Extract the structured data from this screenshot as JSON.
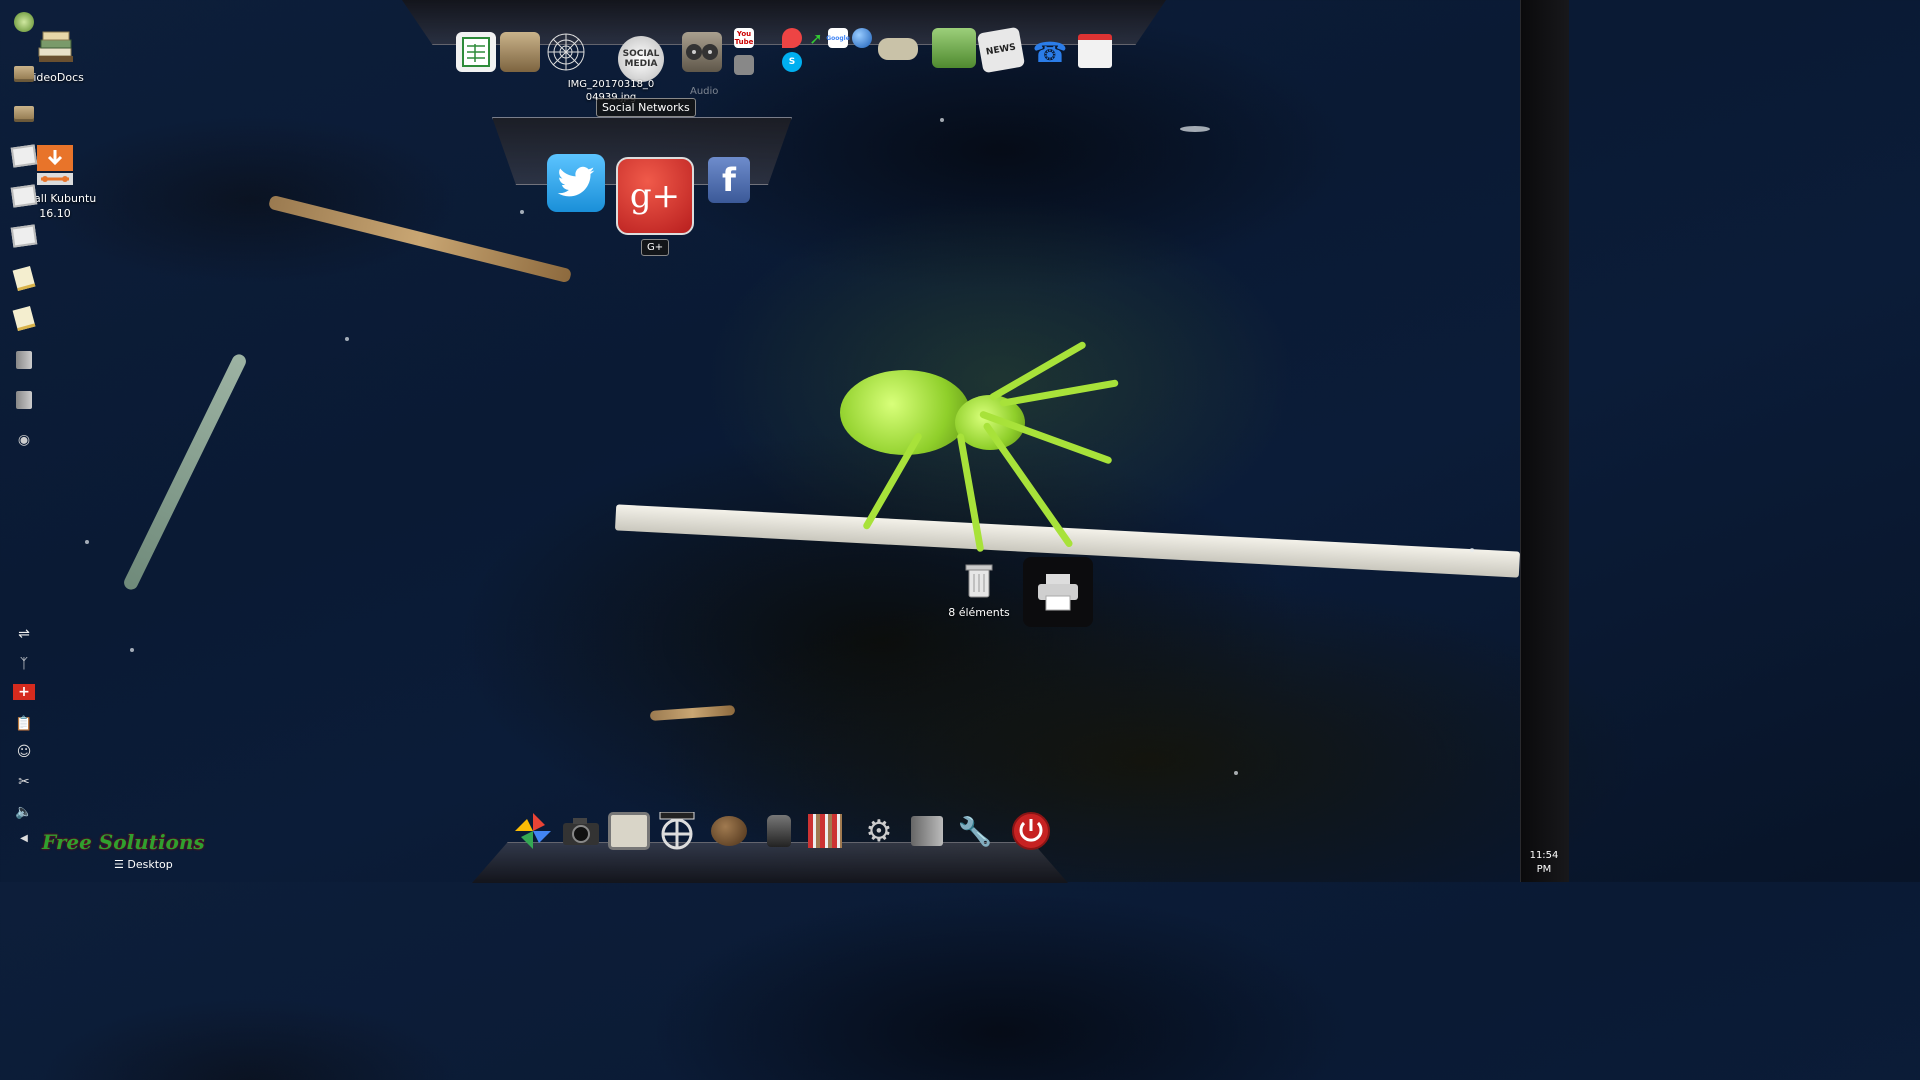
{
  "desktop": {
    "icons": [
      {
        "label": "VideoDocs"
      },
      {
        "label": "Install Kubuntu 16.10"
      },
      {
        "label": "IMG_20170318_004939.jpg"
      },
      {
        "label": "8 éléments"
      }
    ]
  },
  "top_dock": {
    "items": [
      {
        "icon": "spreadsheet-icon"
      },
      {
        "icon": "archive-box-icon"
      },
      {
        "icon": "spiderweb-icon"
      },
      {
        "icon": "social-media-icon"
      },
      {
        "icon": "film-reels-icon"
      },
      {
        "icon": "usb-drive-icon"
      },
      {
        "icon": "youtube-icon",
        "text": "You Tube"
      },
      {
        "icon": "skype-icon",
        "text": "S"
      },
      {
        "icon": "maps-pin-icon"
      },
      {
        "icon": "chart-arrow-icon"
      },
      {
        "icon": "google-icon",
        "text": "Google"
      },
      {
        "icon": "globe-icon"
      },
      {
        "icon": "gamepad-icon"
      },
      {
        "icon": "money-icon"
      },
      {
        "icon": "newspaper-icon",
        "text": "NEWS"
      },
      {
        "icon": "phone-icon"
      },
      {
        "icon": "calendar-icon"
      }
    ],
    "social_media_text": "SOCIAL MEDIA",
    "audio_label": "Audio",
    "tooltip": "Social Networks"
  },
  "social_popup": {
    "items": [
      {
        "icon": "twitter-icon"
      },
      {
        "icon": "google-plus-icon",
        "text": "g+"
      },
      {
        "icon": "facebook-icon",
        "text": "f"
      }
    ],
    "hover_label": "G+"
  },
  "widgets": {
    "trash_label": "8 éléments",
    "printer": "printer-icon"
  },
  "bottom_dock": {
    "items": [
      {
        "icon": "pinwheel-icon"
      },
      {
        "icon": "camera-icon"
      },
      {
        "icon": "tv-icon"
      },
      {
        "icon": "film-icon"
      },
      {
        "icon": "coconut-icon"
      },
      {
        "icon": "ink-bottle-icon"
      },
      {
        "icon": "books-icon"
      },
      {
        "icon": "settings-tools-icon"
      },
      {
        "icon": "panel-icon"
      },
      {
        "icon": "wrench-stars-icon"
      },
      {
        "icon": "power-icon"
      }
    ],
    "logo_text": "Free Solutions",
    "desktop_label": "Desktop"
  },
  "right_panel": {
    "clock_time": "11:54",
    "clock_ampm": "PM"
  },
  "colors": {
    "accent_red": "#d42a2a",
    "twitter": "#1da1f2",
    "facebook": "#3b5998",
    "logo_green": "#2fa02f"
  }
}
